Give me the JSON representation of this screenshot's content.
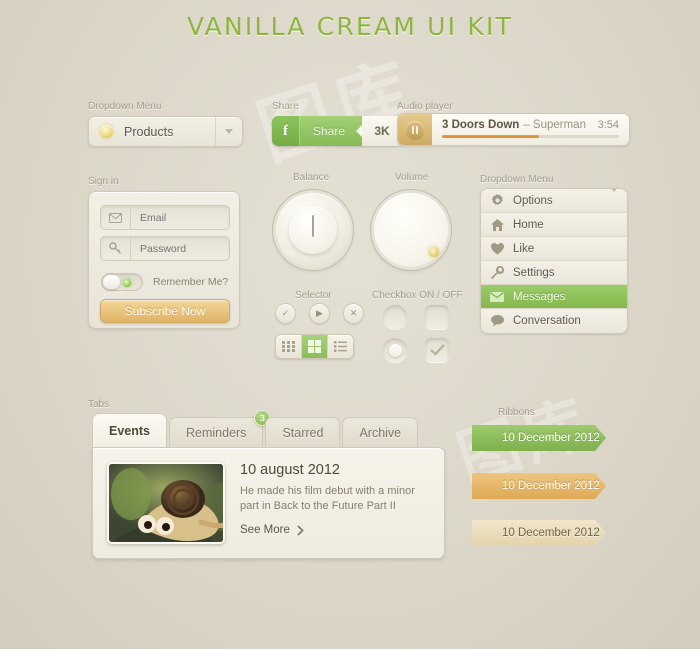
{
  "page": {
    "title": "VANILLA CREAM UI KIT",
    "accent_green": "#8cb63c",
    "background": "#ddd8cb"
  },
  "watermark": {
    "text": "图库"
  },
  "dropdown_closed": {
    "label": "Dropdown Menu",
    "value": "Products",
    "icon": "bulb-icon",
    "caret": "chevron-down-icon"
  },
  "share": {
    "label": "Share",
    "facebook_icon": "f",
    "button_label": "Share",
    "count": "3K",
    "color": "#86bb54"
  },
  "audio": {
    "label": "Audio player",
    "artist": "3 Doors Down",
    "separator": " – ",
    "track": "Superman",
    "duration": "3:54",
    "progress_percent": 55,
    "transport_icon": "pause-icon",
    "progress_color": "#d8892f"
  },
  "signin": {
    "label": "Sign in",
    "email": {
      "placeholder": "Email",
      "value": "",
      "icon": "envelope-icon"
    },
    "password": {
      "placeholder": "Password",
      "value": "",
      "icon": "key-icon"
    },
    "remember": {
      "label": "Remember Me?",
      "state": "off"
    },
    "submit": "Subscribe Now"
  },
  "knobs": [
    {
      "label": "Balance",
      "indicator": "line"
    },
    {
      "label": "Volume",
      "indicator": "dot"
    }
  ],
  "selector": {
    "label": "Selector",
    "buttons": [
      {
        "name": "check-icon",
        "glyph": "✓"
      },
      {
        "name": "play-icon",
        "glyph": "▶"
      },
      {
        "name": "close-icon",
        "glyph": "✕"
      }
    ],
    "segments": [
      {
        "name": "small-grid-icon",
        "active": false
      },
      {
        "name": "large-grid-icon",
        "active": true
      },
      {
        "name": "list-icon",
        "active": false
      }
    ]
  },
  "checkbox": {
    "label": "Checkbox ON / OFF",
    "items": [
      {
        "name": "radio-off",
        "type": "circle",
        "checked": false
      },
      {
        "name": "checkbox-off",
        "type": "square",
        "checked": false
      },
      {
        "name": "radio-on",
        "type": "circle",
        "checked": true
      },
      {
        "name": "checkbox-on",
        "type": "square",
        "checked": true
      }
    ]
  },
  "menu": {
    "label": "Dropdown Menu",
    "items": [
      {
        "label": "Options",
        "icon": "gear-icon",
        "active": false,
        "caret": true
      },
      {
        "label": "Home",
        "icon": "home-icon",
        "active": false,
        "caret": false
      },
      {
        "label": "Like",
        "icon": "heart-icon",
        "active": false,
        "caret": false
      },
      {
        "label": "Settings",
        "icon": "wrench-icon",
        "active": false,
        "caret": false
      },
      {
        "label": "Messages",
        "icon": "envelope-icon",
        "active": true,
        "caret": false
      },
      {
        "label": "Conversation",
        "icon": "chat-bubble-icon",
        "active": false,
        "caret": false
      }
    ]
  },
  "tabs": {
    "label": "Tabs",
    "items": [
      {
        "label": "Events",
        "active": true,
        "badge": ""
      },
      {
        "label": "Reminders",
        "active": false,
        "badge": "3"
      },
      {
        "label": "Starred",
        "active": false,
        "badge": ""
      },
      {
        "label": "Archive",
        "active": false,
        "badge": ""
      }
    ],
    "content": {
      "date": "10 august 2012",
      "description": "He made his film debut with a minor part in Back to the Future Part II",
      "more_label": "See More",
      "more_icon": "chevron-right-icon",
      "thumbnail": "snail-photo"
    }
  },
  "ribbons": {
    "label": "Ribbons",
    "items": [
      {
        "text": "10 December 2012",
        "color": "#7fb14b",
        "style": "green"
      },
      {
        "text": "10 December 2012",
        "color": "#dda955",
        "style": "gold"
      },
      {
        "text": "10 December 2012",
        "color": "#e3d3ab",
        "style": "cream"
      }
    ]
  }
}
